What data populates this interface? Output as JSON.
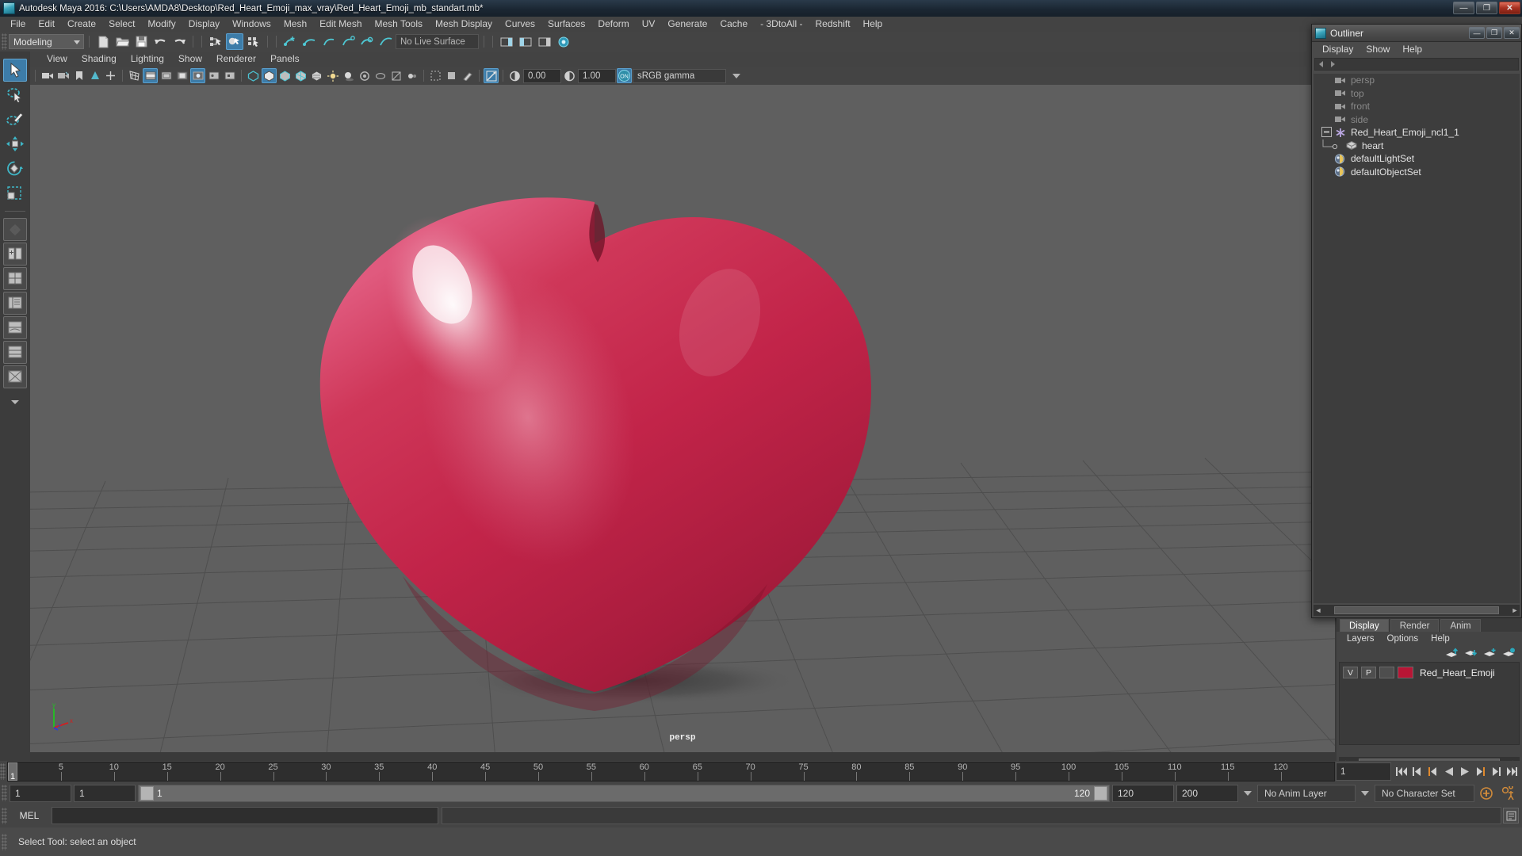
{
  "window": {
    "title": "Autodesk Maya 2016: C:\\Users\\AMDA8\\Desktop\\Red_Heart_Emoji_max_vray\\Red_Heart_Emoji_mb_standart.mb*",
    "minimize": "—",
    "maximize": "❐",
    "close": "✕"
  },
  "menubar": {
    "items": [
      "File",
      "Edit",
      "Create",
      "Select",
      "Modify",
      "Display",
      "Windows",
      "Mesh",
      "Edit Mesh",
      "Mesh Tools",
      "Mesh Display",
      "Curves",
      "Surfaces",
      "Deform",
      "UV",
      "Generate",
      "Cache",
      "- 3DtoAll -",
      "Redshift",
      "Help"
    ]
  },
  "toolbar": {
    "mode": "Modeling",
    "live_surface": "No Live Surface"
  },
  "panel_menu": {
    "items": [
      "View",
      "Shading",
      "Lighting",
      "Show",
      "Renderer",
      "Panels"
    ]
  },
  "panel_bar": {
    "exposure": "0.00",
    "gamma": "1.00",
    "view_transform": "sRGB gamma",
    "cm_toggle": "ON"
  },
  "viewport": {
    "camera_label": "persp",
    "background_color": "#5f5f5f",
    "grid_color": "#4d4d4d",
    "heart_color": "#c2254a",
    "heart_shadow_color": "#474747",
    "axis": {
      "x": "x",
      "y": "y",
      "z": "z",
      "x_color": "#d02020",
      "y_color": "#22c222",
      "z_color": "#2a3ce0"
    }
  },
  "outliner": {
    "title": "Outliner",
    "minimize": "—",
    "maximize": "❐",
    "close": "✕",
    "menu": [
      "Display",
      "Show",
      "Help"
    ],
    "items": [
      {
        "label": "persp",
        "type": "camera",
        "indent": 1,
        "dim": true
      },
      {
        "label": "top",
        "type": "camera",
        "indent": 1,
        "dim": true
      },
      {
        "label": "front",
        "type": "camera",
        "indent": 1,
        "dim": true
      },
      {
        "label": "side",
        "type": "camera",
        "indent": 1,
        "dim": true
      },
      {
        "label": "Red_Heart_Emoji_ncl1_1",
        "type": "transform",
        "indent": 1,
        "dim": false,
        "expanded": true
      },
      {
        "label": "heart",
        "type": "mesh",
        "indent": 2,
        "dim": false
      },
      {
        "label": "defaultLightSet",
        "type": "set",
        "indent": 1,
        "dim": false
      },
      {
        "label": "defaultObjectSet",
        "type": "set",
        "indent": 1,
        "dim": false
      }
    ]
  },
  "layer_editor": {
    "tabs": [
      {
        "label": "Display",
        "active": true
      },
      {
        "label": "Render",
        "active": false
      },
      {
        "label": "Anim",
        "active": false
      }
    ],
    "menu": [
      "Layers",
      "Options",
      "Help"
    ],
    "layers": [
      {
        "visible": "V",
        "playback": "P",
        "type": "",
        "color": "#b81535",
        "name": "Red_Heart_Emoji"
      }
    ]
  },
  "time_slider": {
    "current_frame": "1",
    "end_frame_field": "120",
    "ticks": [
      "5",
      "10",
      "15",
      "20",
      "25",
      "30",
      "35",
      "40",
      "45",
      "50",
      "55",
      "60",
      "65",
      "70",
      "75",
      "80",
      "85",
      "90",
      "95",
      "100",
      "105",
      "110",
      "115",
      "120"
    ],
    "playback_buttons": [
      "go-to-start",
      "step-back-key",
      "step-back-frame",
      "play-backwards",
      "play-forwards",
      "step-forward-frame",
      "step-forward-key",
      "go-to-end"
    ]
  },
  "range_slider": {
    "anim_start": "1",
    "range_start": "1",
    "range_bar_start_label": "1",
    "range_bar_end_label": "120",
    "range_end": "120",
    "anim_end": "200",
    "anim_layer": "No Anim Layer",
    "character_set": "No Character Set"
  },
  "command_line": {
    "language": "MEL",
    "input_value": "",
    "output_value": ""
  },
  "help_line": {
    "message": "Select Tool: select an object"
  },
  "toolbox": {
    "tools": [
      {
        "name": "select-tool",
        "selected": true
      },
      {
        "name": "lasso-select-tool",
        "selected": false
      },
      {
        "name": "paint-select-tool",
        "selected": false
      },
      {
        "name": "move-tool",
        "selected": false
      },
      {
        "name": "rotate-tool",
        "selected": false
      },
      {
        "name": "scale-tool",
        "selected": false
      },
      {
        "name": "last-tool-used",
        "selected": false
      }
    ]
  }
}
